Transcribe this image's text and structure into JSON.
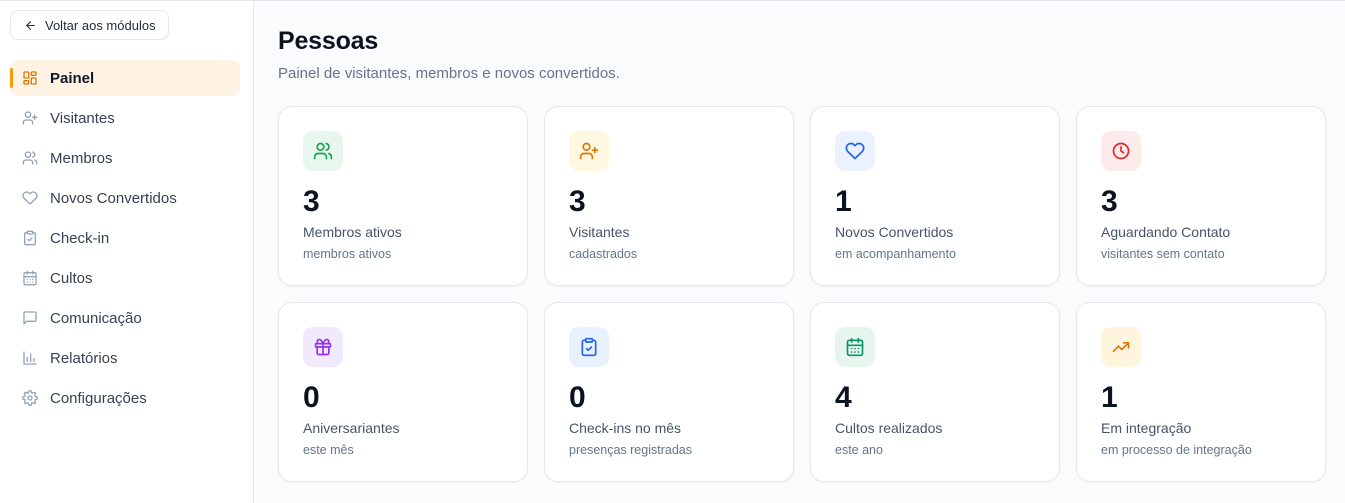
{
  "sidebar": {
    "back_label": "Voltar aos módulos",
    "items": [
      {
        "label": "Painel",
        "icon": "dashboard-icon",
        "active": true
      },
      {
        "label": "Visitantes",
        "icon": "user-plus-icon"
      },
      {
        "label": "Membros",
        "icon": "users-icon"
      },
      {
        "label": "Novos Convertidos",
        "icon": "heart-icon"
      },
      {
        "label": "Check-in",
        "icon": "clipboard-check-icon"
      },
      {
        "label": "Cultos",
        "icon": "calendar-icon"
      },
      {
        "label": "Comunicação",
        "icon": "message-icon"
      },
      {
        "label": "Relatórios",
        "icon": "bar-chart-icon"
      },
      {
        "label": "Configurações",
        "icon": "gear-icon"
      }
    ]
  },
  "header": {
    "title": "Pessoas",
    "subtitle": "Painel de visitantes, membros e novos convertidos."
  },
  "stats": [
    {
      "value": "3",
      "label": "Membros ativos",
      "desc": "membros ativos",
      "icon": "users-icon",
      "color": "#16a34a"
    },
    {
      "value": "3",
      "label": "Visitantes",
      "desc": "cadastrados",
      "icon": "user-plus-icon",
      "color": "#d97706"
    },
    {
      "value": "1",
      "label": "Novos Convertidos",
      "desc": "em acompanhamento",
      "icon": "heart-icon",
      "color": "#2563eb"
    },
    {
      "value": "3",
      "label": "Aguardando Contato",
      "desc": "visitantes sem contato",
      "icon": "clock-icon",
      "color": "#dc2626"
    },
    {
      "value": "0",
      "label": "Aniversariantes",
      "desc": "este mês",
      "icon": "gift-icon",
      "color": "#9333ea"
    },
    {
      "value": "0",
      "label": "Check-ins no mês",
      "desc": "presenças registradas",
      "icon": "clipboard-check-icon",
      "color": "#2563eb"
    },
    {
      "value": "4",
      "label": "Cultos realizados",
      "desc": "este ano",
      "icon": "calendar-icon",
      "color": "#059669"
    },
    {
      "value": "1",
      "label": "Em integração",
      "desc": "em processo de integração",
      "icon": "trending-up-icon",
      "color": "#d97706"
    }
  ]
}
